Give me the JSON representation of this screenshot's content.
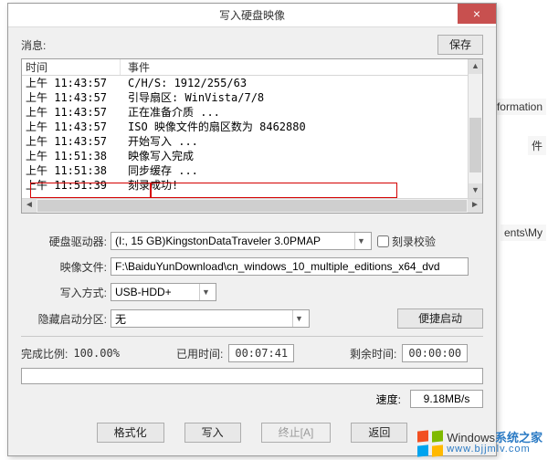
{
  "window": {
    "title": "写入硬盘映像",
    "close_glyph": "×"
  },
  "save_btn": "保存",
  "message_label": "消息:",
  "log": {
    "col_time": "时间",
    "col_event": "事件",
    "rows": [
      {
        "t": "上午 11:43:57",
        "e": "C/H/S: 1912/255/63"
      },
      {
        "t": "上午 11:43:57",
        "e": "引导扇区: WinVista/7/8"
      },
      {
        "t": "上午 11:43:57",
        "e": "正在准备介质 ..."
      },
      {
        "t": "上午 11:43:57",
        "e": "ISO 映像文件的扇区数为 8462880"
      },
      {
        "t": "上午 11:43:57",
        "e": "开始写入 ..."
      },
      {
        "t": "上午 11:51:38",
        "e": "映像写入完成"
      },
      {
        "t": "上午 11:51:38",
        "e": "同步缓存 ..."
      },
      {
        "t": "上午 11:51:39",
        "e": "刻录成功!"
      }
    ],
    "left_arrow": "◄",
    "right_arrow": "►",
    "up_arrow": "▲",
    "down_arrow": "▼"
  },
  "form": {
    "drive_label": "硬盘驱动器:",
    "drive_value": "(I:, 15 GB)KingstonDataTraveler 3.0PMAP",
    "verify_label": "刻录校验",
    "image_label": "映像文件:",
    "image_value": "F:\\BaiduYunDownload\\cn_windows_10_multiple_editions_x64_dvd",
    "write_mode_label": "写入方式:",
    "write_mode_value": "USB-HDD+",
    "hidden_label": "隐藏启动分区:",
    "hidden_value": "无",
    "convenient_btn": "便捷启动"
  },
  "status": {
    "complete_label": "完成比例:",
    "complete_value": "100.00%",
    "elapsed_label": "已用时间:",
    "elapsed_value": "00:07:41",
    "remain_label": "剩余时间:",
    "remain_value": "00:00:00",
    "speed_label": "速度:",
    "speed_value": "9.18MB/s"
  },
  "buttons": {
    "format": "格式化",
    "write": "写入",
    "abort": "终止[A]",
    "back": "返回"
  },
  "bg": {
    "b1": "Information",
    "b2": "件",
    "b3": "ents\\My "
  },
  "watermark": {
    "brand": "Windows",
    "suffix": "系统之家",
    "url": "www.bjjmlv.com"
  }
}
